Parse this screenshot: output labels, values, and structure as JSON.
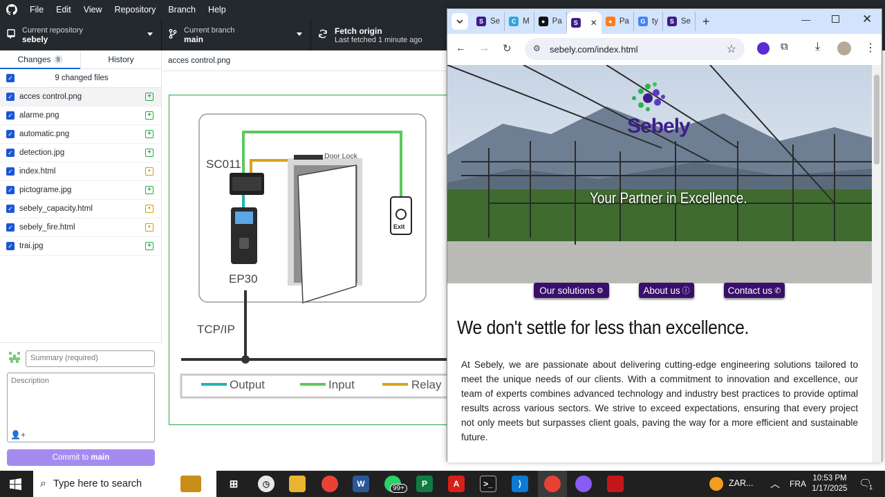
{
  "menu": [
    "File",
    "Edit",
    "View",
    "Repository",
    "Branch",
    "Help"
  ],
  "toolbar": {
    "repo_label": "Current repository",
    "repo_value": "sebely",
    "branch_label": "Current branch",
    "branch_value": "main",
    "fetch_label": "Fetch origin",
    "fetch_sub": "Last fetched 1 minute ago"
  },
  "sidebar": {
    "tab_changes": "Changes",
    "tab_changes_count": "9",
    "tab_history": "History",
    "changed_files": "9 changed files",
    "files": [
      {
        "name": "acces control.png",
        "status": "added"
      },
      {
        "name": "alarme.png",
        "status": "added"
      },
      {
        "name": "automatic.png",
        "status": "added"
      },
      {
        "name": "detection.jpg",
        "status": "added"
      },
      {
        "name": "index.html",
        "status": "modified"
      },
      {
        "name": "pictograme.jpg",
        "status": "added"
      },
      {
        "name": "sebely_capacity.html",
        "status": "modified"
      },
      {
        "name": "sebely_fire.html",
        "status": "modified"
      },
      {
        "name": "trai.jpg",
        "status": "added"
      }
    ],
    "summary_placeholder": "Summary (required)",
    "description_placeholder": "Description",
    "commit_prefix": "Commit to ",
    "commit_branch": "main"
  },
  "diff": {
    "filename": "acces control.png",
    "diagram": {
      "sc_label": "SC011",
      "ep_label": "EP30",
      "door_label": "Door Lock",
      "exit_label": "Exit",
      "tcp_label": "TCP/IP",
      "legend": [
        {
          "label": "Output",
          "color": "#22b5b0"
        },
        {
          "label": "Input",
          "color": "#5cc85c"
        },
        {
          "label": "Relay",
          "color": "#d9a21b"
        }
      ]
    }
  },
  "chrome": {
    "tabs": [
      {
        "title": "Se",
        "icon": "sebely-icon"
      },
      {
        "title": "M",
        "icon": "copilot-icon"
      },
      {
        "title": "Pa",
        "icon": "github-icon"
      },
      {
        "title": "",
        "icon": "sebely-icon",
        "active": true
      },
      {
        "title": "Pa",
        "icon": "firefox-icon"
      },
      {
        "title": "ty",
        "icon": "google-icon"
      },
      {
        "title": "Se",
        "icon": "sebely-icon"
      }
    ],
    "url": "sebely.com/index.html",
    "page": {
      "logo_text": "Sebely",
      "tagline": "Your Partner in Excellence.",
      "nav": [
        {
          "label": "Our solutions",
          "icon": "gears-icon"
        },
        {
          "label": "About us",
          "icon": "info-icon"
        },
        {
          "label": "Contact us",
          "icon": "phone-icon"
        }
      ],
      "headline": "We don't settle for less than excellence.",
      "paragraph": "At Sebely, we are passionate about delivering cutting-edge engineering solutions tailored to meet the unique needs of our clients. With a commitment to innovation and excellence, our team of experts combines advanced technology and industry best practices to provide optimal results across various sectors. We strive to exceed expectations, ensuring that every project not only meets but surpasses client goals, paving the way for a more efficient and sustainable future."
    }
  },
  "taskbar": {
    "search_placeholder": "Type here to search",
    "whatsapp_badge": "99+",
    "weather": "ZAR...",
    "lang": "FRA",
    "time": "10:53 PM",
    "date": "1/17/2025",
    "notif_count": "1"
  }
}
